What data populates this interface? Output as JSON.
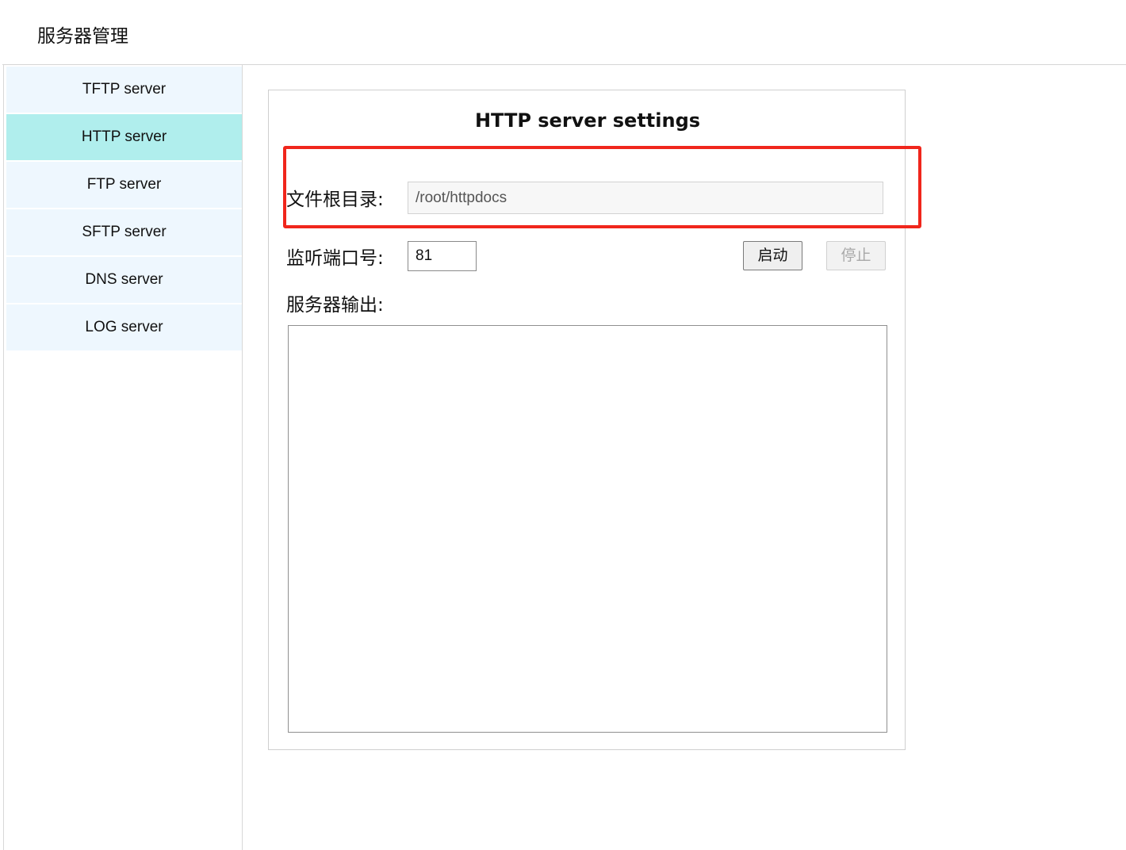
{
  "app": {
    "title": "服务器管理"
  },
  "sidebar": {
    "items": [
      {
        "label": "TFTP server",
        "active": false
      },
      {
        "label": "HTTP server",
        "active": true
      },
      {
        "label": "FTP server",
        "active": false
      },
      {
        "label": "SFTP server",
        "active": false
      },
      {
        "label": "DNS server",
        "active": false
      },
      {
        "label": "LOG server",
        "active": false
      }
    ]
  },
  "panel": {
    "title": "HTTP server settings",
    "root_dir_label": "文件根目录:",
    "root_dir_value": "/root/httpdocs",
    "port_label": "监听端口号:",
    "port_value": "81",
    "start_button": "启动",
    "stop_button": "停止",
    "stop_disabled": true,
    "output_label": "服务器输出:",
    "output_text": ""
  },
  "colors": {
    "active_item": "#b0eeed",
    "sidebar_item": "#eef7fe",
    "highlight": "#f0261c"
  }
}
